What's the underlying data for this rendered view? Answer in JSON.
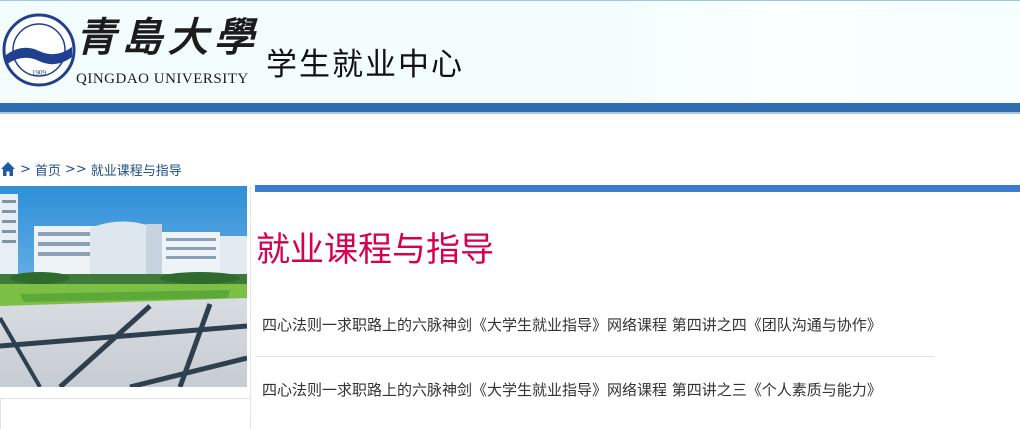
{
  "header": {
    "logo_cn": "青島大學",
    "logo_en": "QINGDAO UNIVERSITY",
    "logo_year": "1909",
    "site_title": "学生就业中心"
  },
  "breadcrumb": {
    "sep1": ">",
    "home_label": "首页",
    "sep2": ">>",
    "current": "就业课程与指导"
  },
  "main": {
    "title": "就业课程与指导",
    "items": [
      {
        "title": "四心法则一求职路上的六脉神剑《大学生就业指导》网络课程  第四讲之四《团队沟通与协作》"
      },
      {
        "title": "四心法则一求职路上的六脉神剑《大学生就业指导》网络课程  第四讲之三《个人素质与能力》"
      }
    ]
  },
  "colors": {
    "brand_blue": "#2f6cb2",
    "title_red": "#d6004f"
  },
  "icons": {
    "home": "home-icon"
  }
}
